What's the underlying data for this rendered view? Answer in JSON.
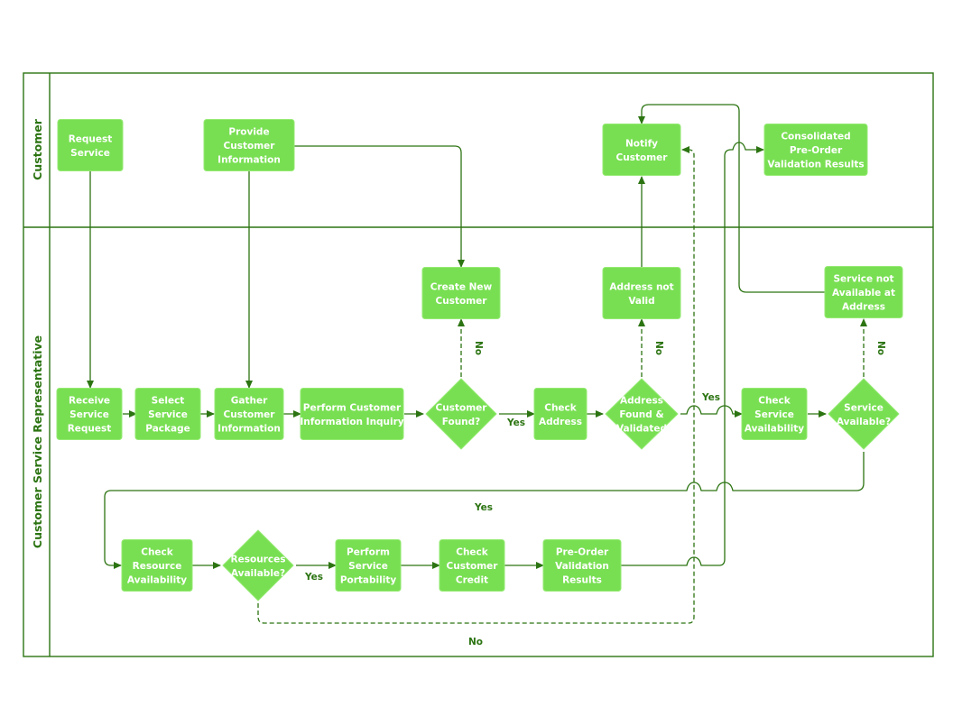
{
  "diagram": {
    "type": "cross-functional flowchart",
    "colors": {
      "node_fill": "#78df52",
      "line": "#2c7412",
      "node_text": "#ffffff"
    },
    "lanes": [
      {
        "id": "customer",
        "label": "Customer"
      },
      {
        "id": "csr",
        "label": "Customer Service Representative"
      }
    ],
    "nodes": [
      {
        "id": "request-service",
        "lane": "customer",
        "shape": "process",
        "label": "Request\nService"
      },
      {
        "id": "provide-info",
        "lane": "customer",
        "shape": "process",
        "label": "Provide\nCustomer\nInformation"
      },
      {
        "id": "notify-customer",
        "lane": "customer",
        "shape": "process",
        "label": "Notify\nCustomer"
      },
      {
        "id": "consolidated",
        "lane": "customer",
        "shape": "process",
        "label": "Consolidated\nPre-Order\nValidation Results"
      },
      {
        "id": "receive-request",
        "lane": "csr",
        "shape": "process",
        "label": "Receive\nService\nRequest"
      },
      {
        "id": "select-package",
        "lane": "csr",
        "shape": "process",
        "label": "Select\nService\nPackage"
      },
      {
        "id": "gather-info",
        "lane": "csr",
        "shape": "process",
        "label": "Gather\nCustomer\nInformation"
      },
      {
        "id": "perform-inquiry",
        "lane": "csr",
        "shape": "process",
        "label": "Perform Customer\nInformation Inquiry"
      },
      {
        "id": "customer-found",
        "lane": "csr",
        "shape": "decision",
        "label": "Customer\nFound?"
      },
      {
        "id": "create-customer",
        "lane": "csr",
        "shape": "process",
        "label": "Create New\nCustomer"
      },
      {
        "id": "check-address",
        "lane": "csr",
        "shape": "process",
        "label": "Check\nAddress"
      },
      {
        "id": "address-valid",
        "lane": "csr",
        "shape": "decision",
        "label": "Address\nFound &\nValidated"
      },
      {
        "id": "address-not-valid",
        "lane": "csr",
        "shape": "process",
        "label": "Address not\nValid"
      },
      {
        "id": "check-service",
        "lane": "csr",
        "shape": "process",
        "label": "Check\nService\nAvailability"
      },
      {
        "id": "service-available",
        "lane": "csr",
        "shape": "decision",
        "label": "Service\nAvailable?"
      },
      {
        "id": "service-not-available",
        "lane": "csr",
        "shape": "process",
        "label": "Service not\nAvailable at\nAddress"
      },
      {
        "id": "check-resource",
        "lane": "csr",
        "shape": "process",
        "label": "Check\nResource\nAvailability"
      },
      {
        "id": "resources-available",
        "lane": "csr",
        "shape": "decision",
        "label": "Resources\nAvailable?"
      },
      {
        "id": "service-portability",
        "lane": "csr",
        "shape": "process",
        "label": "Perform\nService\nPortability"
      },
      {
        "id": "check-credit",
        "lane": "csr",
        "shape": "process",
        "label": "Check\nCustomer\nCredit"
      },
      {
        "id": "preorder-results",
        "lane": "csr",
        "shape": "process",
        "label": "Pre-Order\nValidation\nResults"
      }
    ],
    "edges": [
      {
        "from": "request-service",
        "to": "receive-request",
        "label": "",
        "style": "solid"
      },
      {
        "from": "provide-info",
        "to": "gather-info",
        "label": "",
        "style": "solid"
      },
      {
        "from": "provide-info",
        "to": "create-customer",
        "label": "",
        "style": "solid"
      },
      {
        "from": "receive-request",
        "to": "select-package",
        "label": "",
        "style": "solid"
      },
      {
        "from": "select-package",
        "to": "gather-info",
        "label": "",
        "style": "solid"
      },
      {
        "from": "gather-info",
        "to": "perform-inquiry",
        "label": "",
        "style": "solid"
      },
      {
        "from": "perform-inquiry",
        "to": "customer-found",
        "label": "",
        "style": "solid"
      },
      {
        "from": "customer-found",
        "to": "create-customer",
        "label": "No",
        "style": "dashed"
      },
      {
        "from": "customer-found",
        "to": "check-address",
        "label": "Yes",
        "style": "solid"
      },
      {
        "from": "check-address",
        "to": "address-valid",
        "label": "",
        "style": "solid"
      },
      {
        "from": "address-valid",
        "to": "address-not-valid",
        "label": "No",
        "style": "dashed"
      },
      {
        "from": "address-not-valid",
        "to": "notify-customer",
        "label": "",
        "style": "solid"
      },
      {
        "from": "address-valid",
        "to": "check-service",
        "label": "Yes",
        "style": "solid"
      },
      {
        "from": "check-service",
        "to": "service-available",
        "label": "",
        "style": "solid"
      },
      {
        "from": "service-available",
        "to": "service-not-available",
        "label": "No",
        "style": "dashed"
      },
      {
        "from": "service-not-available",
        "to": "notify-customer",
        "label": "",
        "style": "solid"
      },
      {
        "from": "service-available",
        "to": "check-resource",
        "label": "Yes",
        "style": "solid"
      },
      {
        "from": "check-resource",
        "to": "resources-available",
        "label": "",
        "style": "solid"
      },
      {
        "from": "resources-available",
        "to": "service-portability",
        "label": "Yes",
        "style": "solid"
      },
      {
        "from": "resources-available",
        "to": "notify-customer",
        "label": "No",
        "style": "dashed"
      },
      {
        "from": "service-portability",
        "to": "check-credit",
        "label": "",
        "style": "solid"
      },
      {
        "from": "check-credit",
        "to": "preorder-results",
        "label": "",
        "style": "solid"
      },
      {
        "from": "preorder-results",
        "to": "consolidated",
        "label": "",
        "style": "solid"
      }
    ]
  }
}
